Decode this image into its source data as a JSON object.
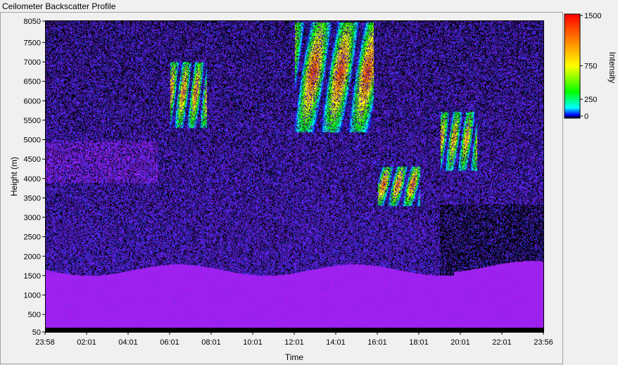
{
  "window": {
    "title": "Ceilometer Backscatter Profile"
  },
  "chart_data": {
    "type": "heatmap",
    "title": "Ceilometer Backscatter Profile",
    "xlabel": "Time",
    "ylabel": "Height (m)",
    "x_ticks": [
      "23:58",
      "02:01",
      "04:01",
      "06:01",
      "08:01",
      "10:01",
      "12:01",
      "14:01",
      "16:01",
      "18:01",
      "20:01",
      "22:01",
      "23:56"
    ],
    "y_ticks": [
      8050,
      7500,
      7000,
      6500,
      6000,
      5500,
      5000,
      4500,
      4000,
      3500,
      3000,
      2500,
      2000,
      1500,
      1000,
      500,
      50
    ],
    "ylim": [
      50,
      8050
    ],
    "colorbar": {
      "label": "Intensity",
      "ticks": [
        1500,
        750,
        250,
        0
      ],
      "colors": [
        "#000000",
        "#0000ff",
        "#00ffff",
        "#00ff00",
        "#ffff00",
        "#ff8000",
        "#ff0000"
      ]
    },
    "background_colors": {
      "noise_dark": "#000000",
      "noise_mid": "#5a1fd8",
      "boundary_layer": "#a020f0"
    },
    "features": [
      {
        "name": "boundary layer",
        "x_start": "23:58",
        "x_end": "23:56",
        "height_top_m": 1650
      },
      {
        "name": "cloud band",
        "x_start": "06:01",
        "x_end": "07:45",
        "height_low_m": 5300,
        "height_high_m": 7000,
        "peak_intensity": 1100
      },
      {
        "name": "cloud band",
        "x_start": "12:01",
        "x_end": "15:45",
        "height_low_m": 5200,
        "height_high_m": 8000,
        "peak_intensity": 1300
      },
      {
        "name": "cloud band",
        "x_start": "16:00",
        "x_end": "18:00",
        "height_low_m": 3300,
        "height_high_m": 4300,
        "peak_intensity": 1200
      },
      {
        "name": "cloud band",
        "x_start": "19:00",
        "x_end": "20:45",
        "height_low_m": 4200,
        "height_high_m": 5700,
        "peak_intensity": 1000
      }
    ]
  }
}
